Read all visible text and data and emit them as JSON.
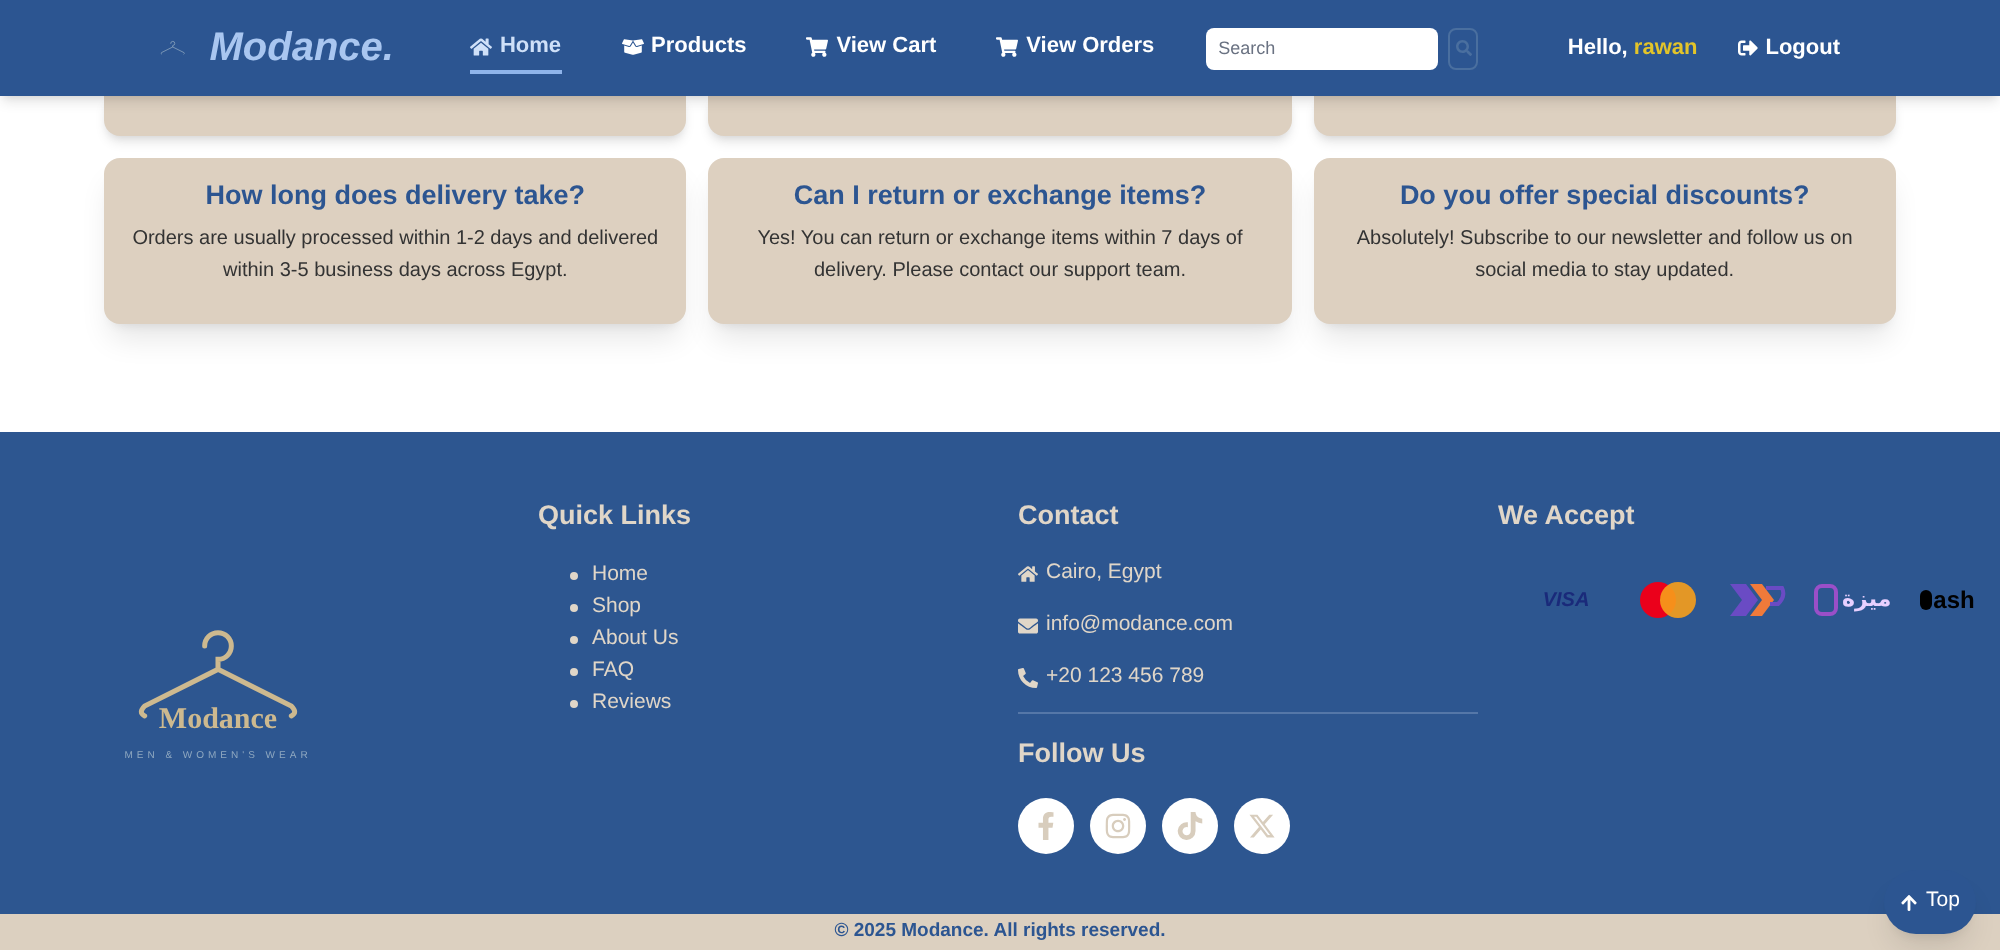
{
  "navbar": {
    "brand": "Modance.",
    "links": [
      {
        "kind": "home",
        "label": "Home",
        "selected": true
      },
      {
        "kind": "products",
        "label": "Products",
        "selected": false
      },
      {
        "kind": "cart",
        "label": "View Cart",
        "selected": false
      },
      {
        "kind": "orders",
        "label": "View Orders",
        "selected": false
      }
    ],
    "search": {
      "placeholder": "Search"
    },
    "greeting": "Hello,",
    "username": "rawan",
    "logout": "Logout"
  },
  "faq": [
    {
      "question": "How long does delivery take?",
      "answer": "Orders are usually processed within 1-2 days and delivered within 3-5 business days across Egypt."
    },
    {
      "question": "Can I return or exchange items?",
      "answer": "Yes! You can return or exchange items within 7 days of delivery. Please contact our support team."
    },
    {
      "question": "Do you offer special discounts?",
      "answer": "Absolutely! Subscribe to our newsletter and follow us on social media to stay updated."
    }
  ],
  "footer": {
    "logo": {
      "name": "Modance",
      "tagline": "MEN & WOMEN'S WEAR"
    },
    "quick_links": {
      "title": "Quick Links",
      "items": [
        "Home",
        "Shop",
        "About Us",
        "FAQ",
        "Reviews"
      ]
    },
    "contact": {
      "title": "Contact",
      "items": [
        {
          "kind": "address",
          "text": "Cairo, Egypt"
        },
        {
          "kind": "email",
          "text": "info@modance.com"
        },
        {
          "kind": "phone",
          "text": "+20 123 456 789"
        }
      ]
    },
    "follow": {
      "title": "Follow Us",
      "items": [
        {
          "kind": "facebook"
        },
        {
          "kind": "instagram"
        },
        {
          "kind": "tiktok"
        },
        {
          "kind": "x"
        }
      ]
    },
    "payments": {
      "title": "We Accept",
      "items": [
        {
          "kind": "visa",
          "label": "VISA"
        },
        {
          "kind": "mastercard"
        },
        {
          "kind": "arrow"
        },
        {
          "kind": "meeza",
          "label": "ميزة"
        },
        {
          "kind": "cash",
          "label": "ash"
        }
      ]
    }
  },
  "copyright": "© 2025 Modance. All rights reserved.",
  "top_button": "Top"
}
